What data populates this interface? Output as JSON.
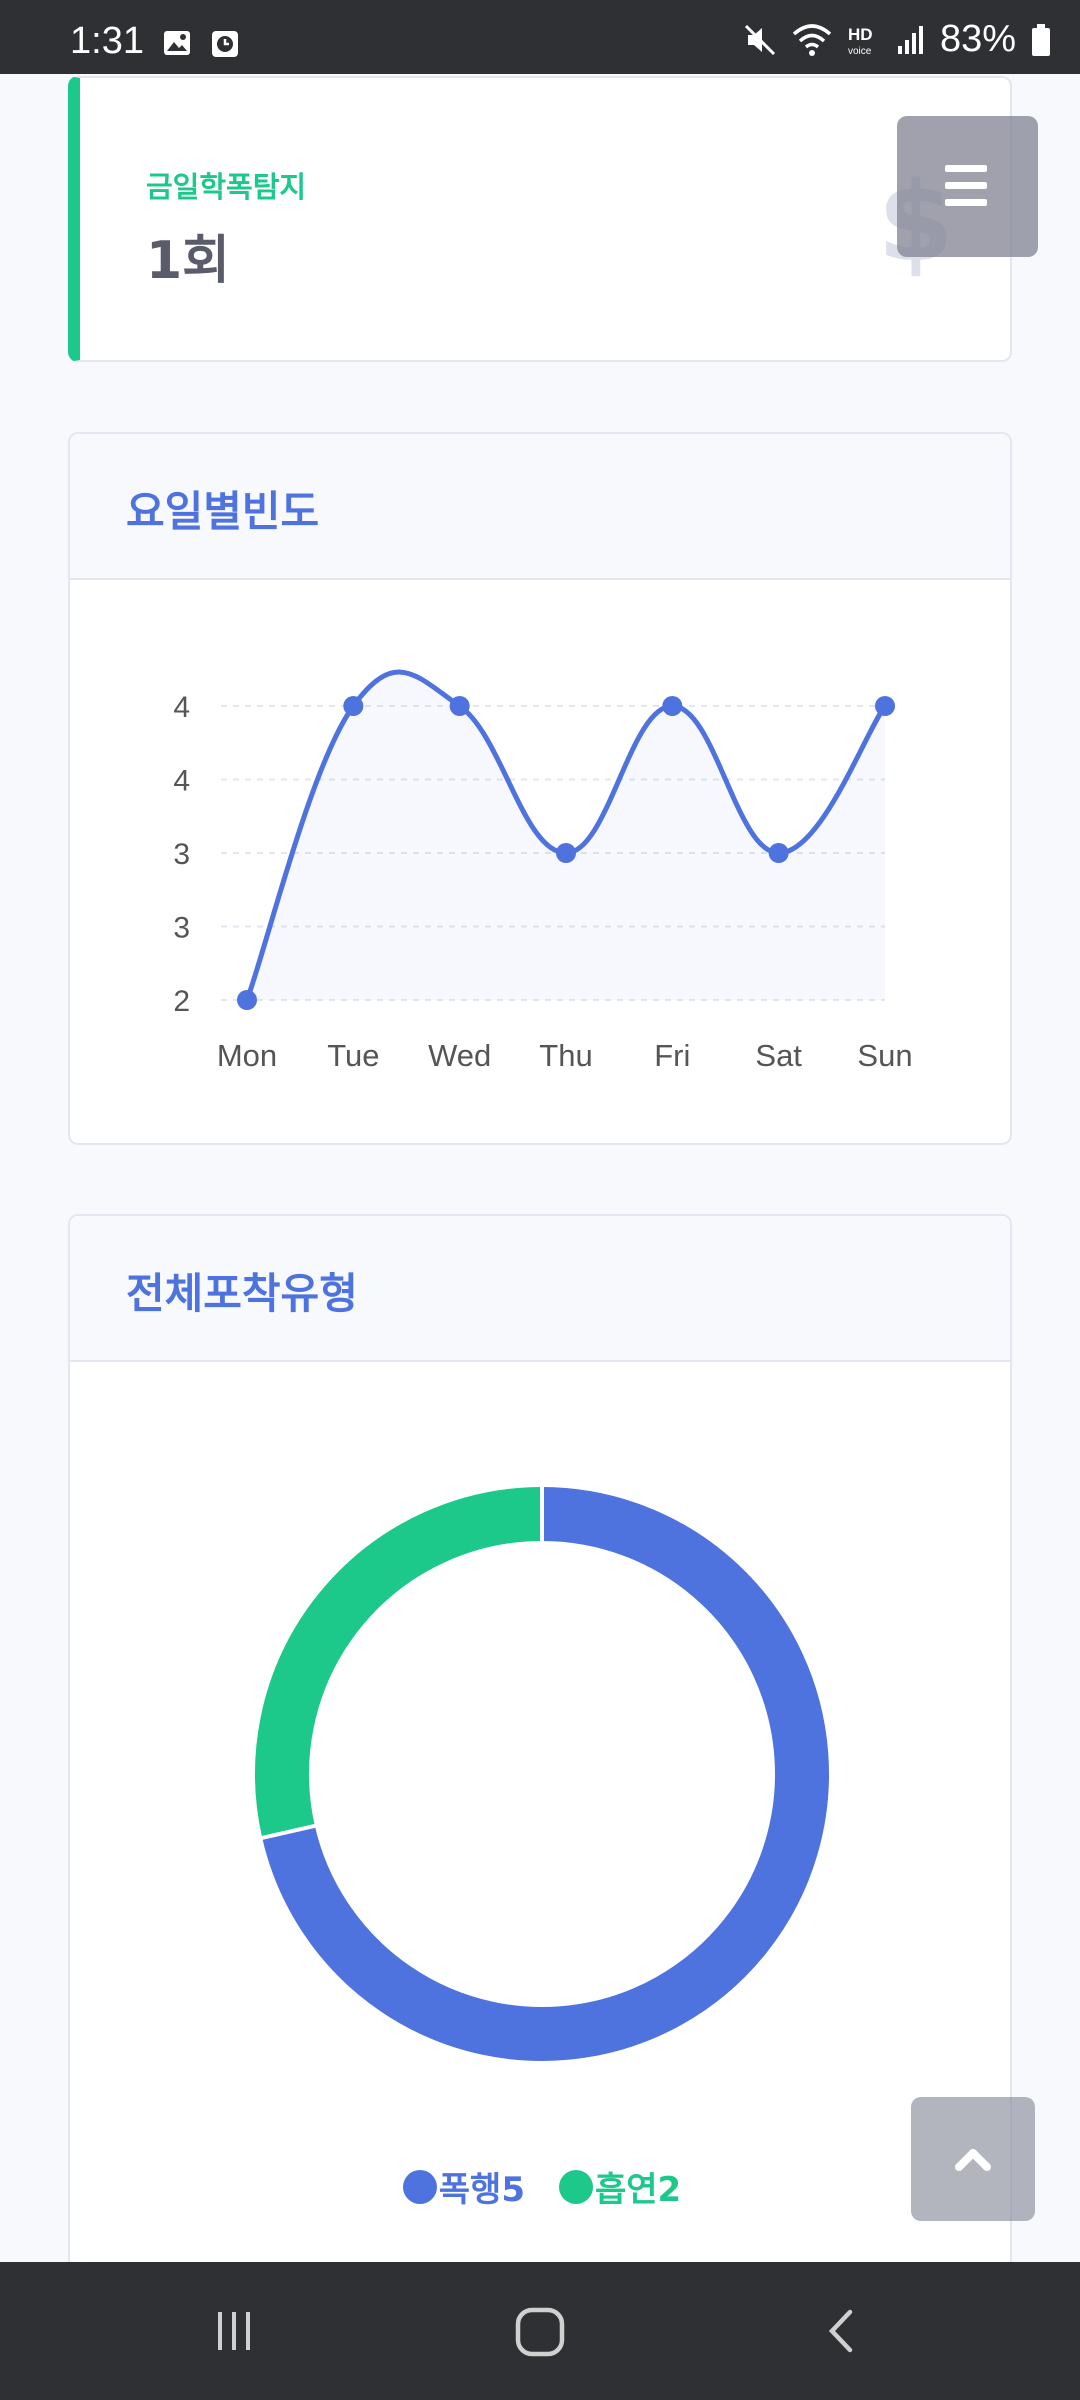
{
  "status_bar": {
    "time": "1:31",
    "battery_text": "83%",
    "icons": [
      "image-icon",
      "clock-app-icon",
      "mute-icon",
      "wifi-icon",
      "hd-voice-icon",
      "signal-icon",
      "battery-icon"
    ]
  },
  "stat_card": {
    "label": "금일학폭탐지",
    "value": "1회",
    "icon": "$",
    "accent_color": "#1cc88a"
  },
  "menu_button": {
    "icon": "hamburger-menu-icon"
  },
  "weekday_chart": {
    "title": "요일별빈도",
    "color": "#4e73df"
  },
  "type_chart": {
    "title": "전체포착유형",
    "legend": [
      {
        "label": "폭행5",
        "color": "#4e73df"
      },
      {
        "label": "흡연2",
        "color": "#1cc88a"
      }
    ]
  },
  "scroll_top_button": {
    "icon": "chevron-up-icon"
  },
  "nav_bar": {
    "icons": [
      "recent-apps-icon",
      "home-icon",
      "back-icon"
    ]
  },
  "chart_data": [
    {
      "type": "line",
      "categories": [
        "Mon",
        "Tue",
        "Wed",
        "Thu",
        "Fri",
        "Sat",
        "Sun"
      ],
      "series": [
        {
          "values": [
            2,
            4,
            4,
            3,
            4,
            3,
            4
          ]
        }
      ],
      "y_tick_labels": [
        "4",
        "4",
        "3",
        "3",
        "2"
      ],
      "ylim": [
        2,
        4
      ],
      "grid": true,
      "area_fill": true
    },
    {
      "type": "pie",
      "donut": true,
      "categories": [
        "폭행",
        "흡연"
      ],
      "values": [
        5,
        2
      ],
      "colors": [
        "#4e73df",
        "#1cc88a"
      ]
    }
  ]
}
